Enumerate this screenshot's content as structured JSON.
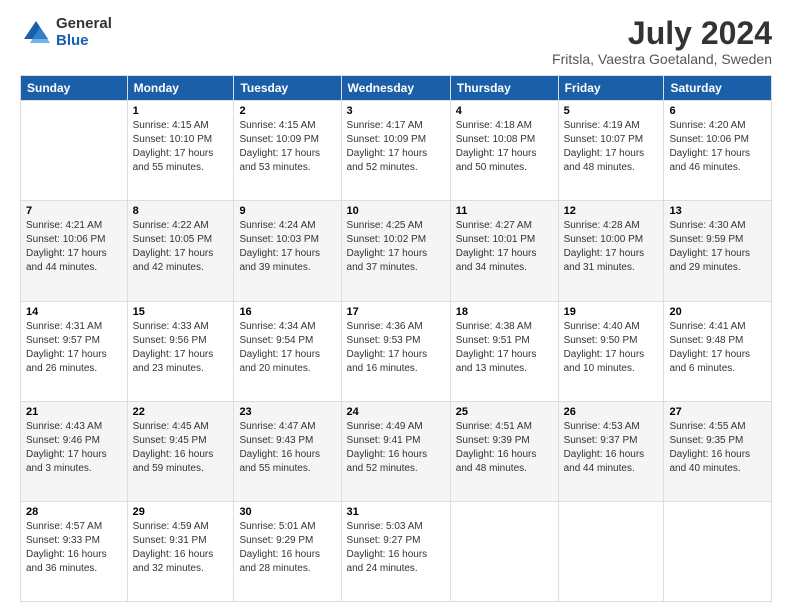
{
  "logo": {
    "general": "General",
    "blue": "Blue"
  },
  "title": "July 2024",
  "subtitle": "Fritsla, Vaestra Goetaland, Sweden",
  "days_of_week": [
    "Sunday",
    "Monday",
    "Tuesday",
    "Wednesday",
    "Thursday",
    "Friday",
    "Saturday"
  ],
  "weeks": [
    [
      {
        "day": "",
        "info": ""
      },
      {
        "day": "1",
        "info": "Sunrise: 4:15 AM\nSunset: 10:10 PM\nDaylight: 17 hours\nand 55 minutes."
      },
      {
        "day": "2",
        "info": "Sunrise: 4:15 AM\nSunset: 10:09 PM\nDaylight: 17 hours\nand 53 minutes."
      },
      {
        "day": "3",
        "info": "Sunrise: 4:17 AM\nSunset: 10:09 PM\nDaylight: 17 hours\nand 52 minutes."
      },
      {
        "day": "4",
        "info": "Sunrise: 4:18 AM\nSunset: 10:08 PM\nDaylight: 17 hours\nand 50 minutes."
      },
      {
        "day": "5",
        "info": "Sunrise: 4:19 AM\nSunset: 10:07 PM\nDaylight: 17 hours\nand 48 minutes."
      },
      {
        "day": "6",
        "info": "Sunrise: 4:20 AM\nSunset: 10:06 PM\nDaylight: 17 hours\nand 46 minutes."
      }
    ],
    [
      {
        "day": "7",
        "info": "Sunrise: 4:21 AM\nSunset: 10:06 PM\nDaylight: 17 hours\nand 44 minutes."
      },
      {
        "day": "8",
        "info": "Sunrise: 4:22 AM\nSunset: 10:05 PM\nDaylight: 17 hours\nand 42 minutes."
      },
      {
        "day": "9",
        "info": "Sunrise: 4:24 AM\nSunset: 10:03 PM\nDaylight: 17 hours\nand 39 minutes."
      },
      {
        "day": "10",
        "info": "Sunrise: 4:25 AM\nSunset: 10:02 PM\nDaylight: 17 hours\nand 37 minutes."
      },
      {
        "day": "11",
        "info": "Sunrise: 4:27 AM\nSunset: 10:01 PM\nDaylight: 17 hours\nand 34 minutes."
      },
      {
        "day": "12",
        "info": "Sunrise: 4:28 AM\nSunset: 10:00 PM\nDaylight: 17 hours\nand 31 minutes."
      },
      {
        "day": "13",
        "info": "Sunrise: 4:30 AM\nSunset: 9:59 PM\nDaylight: 17 hours\nand 29 minutes."
      }
    ],
    [
      {
        "day": "14",
        "info": "Sunrise: 4:31 AM\nSunset: 9:57 PM\nDaylight: 17 hours\nand 26 minutes."
      },
      {
        "day": "15",
        "info": "Sunrise: 4:33 AM\nSunset: 9:56 PM\nDaylight: 17 hours\nand 23 minutes."
      },
      {
        "day": "16",
        "info": "Sunrise: 4:34 AM\nSunset: 9:54 PM\nDaylight: 17 hours\nand 20 minutes."
      },
      {
        "day": "17",
        "info": "Sunrise: 4:36 AM\nSunset: 9:53 PM\nDaylight: 17 hours\nand 16 minutes."
      },
      {
        "day": "18",
        "info": "Sunrise: 4:38 AM\nSunset: 9:51 PM\nDaylight: 17 hours\nand 13 minutes."
      },
      {
        "day": "19",
        "info": "Sunrise: 4:40 AM\nSunset: 9:50 PM\nDaylight: 17 hours\nand 10 minutes."
      },
      {
        "day": "20",
        "info": "Sunrise: 4:41 AM\nSunset: 9:48 PM\nDaylight: 17 hours\nand 6 minutes."
      }
    ],
    [
      {
        "day": "21",
        "info": "Sunrise: 4:43 AM\nSunset: 9:46 PM\nDaylight: 17 hours\nand 3 minutes."
      },
      {
        "day": "22",
        "info": "Sunrise: 4:45 AM\nSunset: 9:45 PM\nDaylight: 16 hours\nand 59 minutes."
      },
      {
        "day": "23",
        "info": "Sunrise: 4:47 AM\nSunset: 9:43 PM\nDaylight: 16 hours\nand 55 minutes."
      },
      {
        "day": "24",
        "info": "Sunrise: 4:49 AM\nSunset: 9:41 PM\nDaylight: 16 hours\nand 52 minutes."
      },
      {
        "day": "25",
        "info": "Sunrise: 4:51 AM\nSunset: 9:39 PM\nDaylight: 16 hours\nand 48 minutes."
      },
      {
        "day": "26",
        "info": "Sunrise: 4:53 AM\nSunset: 9:37 PM\nDaylight: 16 hours\nand 44 minutes."
      },
      {
        "day": "27",
        "info": "Sunrise: 4:55 AM\nSunset: 9:35 PM\nDaylight: 16 hours\nand 40 minutes."
      }
    ],
    [
      {
        "day": "28",
        "info": "Sunrise: 4:57 AM\nSunset: 9:33 PM\nDaylight: 16 hours\nand 36 minutes."
      },
      {
        "day": "29",
        "info": "Sunrise: 4:59 AM\nSunset: 9:31 PM\nDaylight: 16 hours\nand 32 minutes."
      },
      {
        "day": "30",
        "info": "Sunrise: 5:01 AM\nSunset: 9:29 PM\nDaylight: 16 hours\nand 28 minutes."
      },
      {
        "day": "31",
        "info": "Sunrise: 5:03 AM\nSunset: 9:27 PM\nDaylight: 16 hours\nand 24 minutes."
      },
      {
        "day": "",
        "info": ""
      },
      {
        "day": "",
        "info": ""
      },
      {
        "day": "",
        "info": ""
      }
    ]
  ]
}
